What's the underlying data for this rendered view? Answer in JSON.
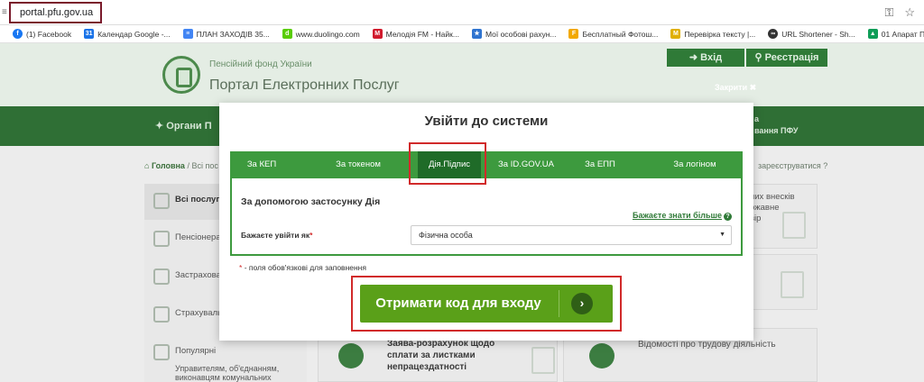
{
  "browser": {
    "url": "portal.pfu.gov.ua",
    "bookmarks": [
      {
        "label": "(1) Facebook",
        "icon": "facebook-icon",
        "color": "#1877f2"
      },
      {
        "label": "Календар Google -...",
        "icon": "calendar-icon",
        "color": "#1a73e8"
      },
      {
        "label": "ПЛАН ЗАХОДІВ 35...",
        "icon": "docs-icon",
        "color": "#4285f4"
      },
      {
        "label": "www.duolingo.com",
        "icon": "duolingo-icon",
        "color": "#58cc02"
      },
      {
        "label": "Мелодія FM - Найк...",
        "icon": "melodia-icon",
        "color": "#d11b2e"
      },
      {
        "label": "Мої особові рахун...",
        "icon": "ukraine-icon",
        "color": "#2f74d0"
      },
      {
        "label": "Бесплатный Фотош...",
        "icon": "photoshop-icon",
        "color": "#f2a900"
      },
      {
        "label": "Перевірка тексту |...",
        "icon": "text-check-icon",
        "color": "#e0b000"
      },
      {
        "label": "URL Shortener - Sh...",
        "icon": "link-icon",
        "color": "#333333"
      },
      {
        "label": "01 Апарат ПФУ.xlsx...",
        "icon": "drive-icon",
        "color": "#0f9d58"
      }
    ]
  },
  "site": {
    "org_name": "Пенсійний фонд України",
    "portal_name": "Портал Електронних Послуг",
    "login_label": "Вхід",
    "register_label": "Реєстрація",
    "close_label": "Закрити",
    "nav_left": "Органи П",
    "nav_right_line1": "а",
    "nav_right_line2": "вання ПФУ",
    "breadcrumb_home": "Головна",
    "breadcrumb_rest": "/ Всі пос",
    "breadcrumb_right": "зареєструватися",
    "sidebar": [
      {
        "label": "Всі послуги"
      },
      {
        "label": "Пенсіонера"
      },
      {
        "label": "Застрахова"
      },
      {
        "label": "Страхуваль"
      },
      {
        "label": "Популярні"
      }
    ],
    "sidebar_sub": "Управителям, об'єднанням, виконавцям комунальних",
    "card_right_text1": "них внесків",
    "card_right_text2": "ржавне",
    "card_right_text3": "вір",
    "bottom_card1": "Заява-розрахунок щодо сплати за листками непрацездатності",
    "bottom_card2": "Відомості про трудову діяльність"
  },
  "modal": {
    "title": "Увійти до системи",
    "tabs": [
      {
        "label": "За КЕП",
        "active": false
      },
      {
        "label": "За токеном",
        "active": false
      },
      {
        "label": "Дія.Підпис",
        "active": true
      },
      {
        "label": "За ID.GOV.UA",
        "active": false
      },
      {
        "label": "За ЕПП",
        "active": false
      },
      {
        "label": "За логіном",
        "active": false
      }
    ],
    "heading": "За допомогою застосунку Дія",
    "learn_more": "Бажаєте знати більше",
    "field_label": "Бажаєте увійти як",
    "required_mark": "*",
    "select_value": "Фізична особа",
    "required_note": "- поля обов'язкові для заповнення",
    "cta_label": "Отримати код для входу"
  },
  "colors": {
    "primary_green": "#3d9a3e",
    "active_tab": "#1f6b28",
    "cta_green": "#5aa019",
    "highlight_red": "#d12a2a"
  }
}
